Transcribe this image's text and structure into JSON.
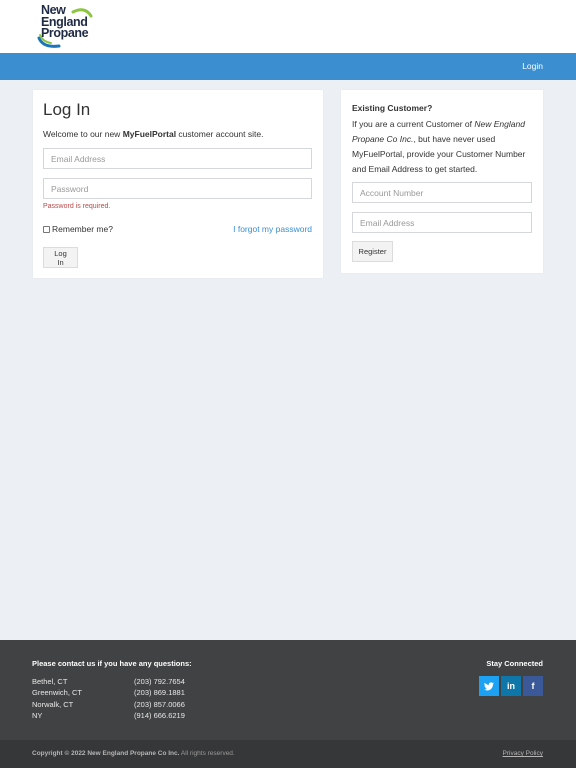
{
  "header": {
    "logo_lines": [
      "New",
      "England",
      "Propane"
    ],
    "logo_colors": {
      "text": "#1f2a44",
      "swoosh_green": "#8cc63f",
      "swoosh_blue": "#1b75bb"
    }
  },
  "nav": {
    "login_label": "Login",
    "bar_color": "#3b8fd0"
  },
  "login": {
    "title": "Log In",
    "welcome_prefix": "Welcome to our new ",
    "welcome_brand": "MyFuelPortal",
    "welcome_suffix": " customer account site.",
    "email_placeholder": "Email Address",
    "password_placeholder": "Password",
    "password_error": "Password is required.",
    "remember_label": "Remember me?",
    "forgot_label": "I forgot my password",
    "submit_label": "Log In"
  },
  "register": {
    "heading": "Existing Customer?",
    "text_part1": "If you are a current Customer of ",
    "text_company": "New England Propane Co Inc.",
    "text_part2": ", but have never used MyFuelPortal, provide your Customer Number and Email Address to get started.",
    "account_placeholder": "Account Number",
    "email_placeholder": "Email Address",
    "submit_label": "Register"
  },
  "footer": {
    "contact_heading": "Please contact us if you have any questions:",
    "contacts": [
      {
        "city": "Bethel, CT",
        "phone": "(203) 792.7654"
      },
      {
        "city": "Greenwich, CT",
        "phone": "(203) 869.1881"
      },
      {
        "city": "Norwalk, CT",
        "phone": "(203) 857.0066"
      },
      {
        "city": "NY",
        "phone": "(914) 666.6219"
      }
    ],
    "stay_connected": "Stay Connected",
    "social": [
      {
        "name": "twitter-icon",
        "glyph": "t"
      },
      {
        "name": "linkedin-icon",
        "glyph": "in"
      },
      {
        "name": "facebook-icon",
        "glyph": "f"
      }
    ],
    "copyright_main": "Copyright © 2022 New England Propane Co Inc.",
    "copyright_rest": " All rights reserved.",
    "privacy_label": "Privacy Policy"
  }
}
